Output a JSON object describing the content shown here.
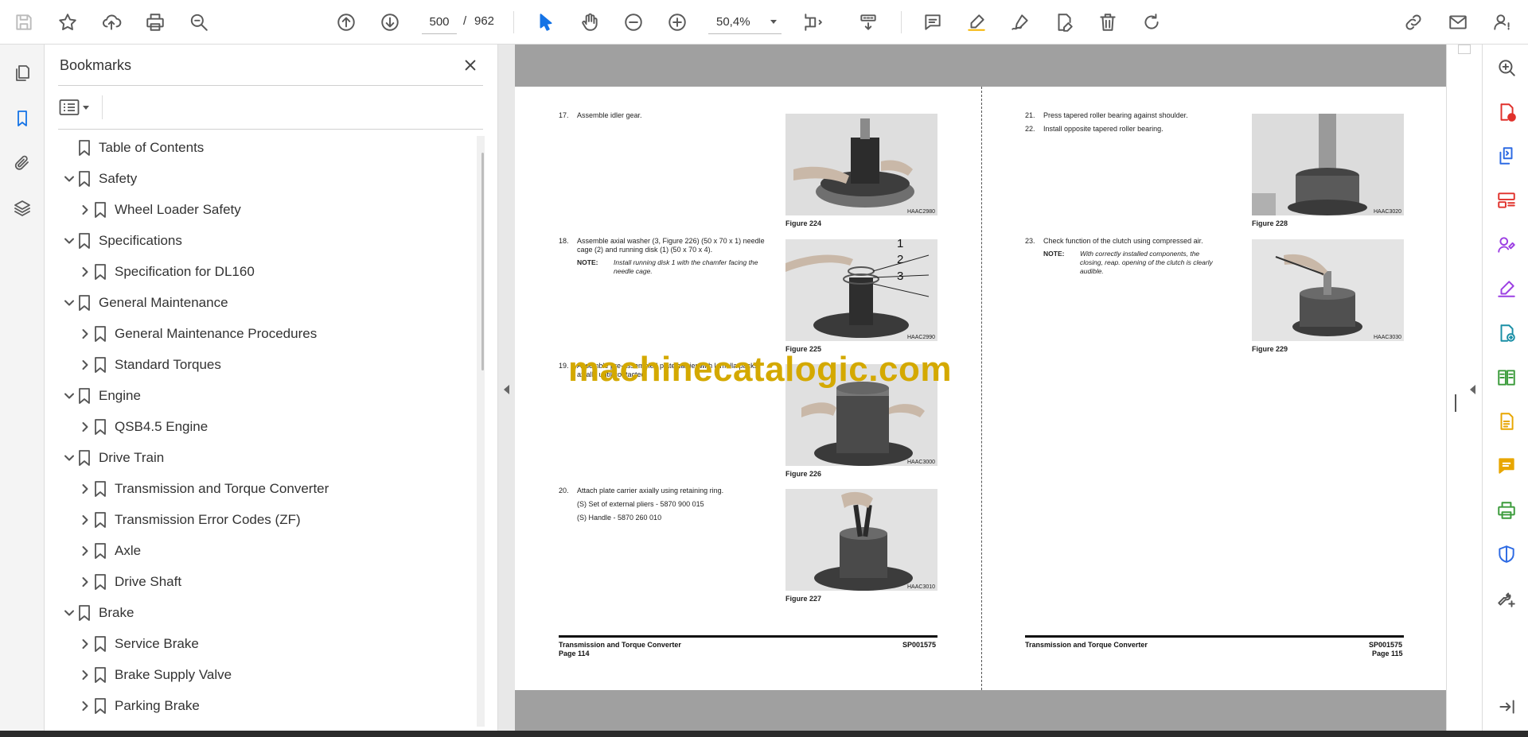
{
  "toolbar": {
    "page_current": "500",
    "page_separator": "/",
    "page_total": "962",
    "zoom": "50,4%"
  },
  "bookmarks": {
    "title": "Bookmarks",
    "items": [
      {
        "label": "Table of Contents",
        "level": 0,
        "chevron": "none"
      },
      {
        "label": "Safety",
        "level": 0,
        "chevron": "down"
      },
      {
        "label": "Wheel Loader Safety",
        "level": 1,
        "chevron": "right"
      },
      {
        "label": "Specifications",
        "level": 0,
        "chevron": "down"
      },
      {
        "label": "Specification for DL160",
        "level": 1,
        "chevron": "right"
      },
      {
        "label": "General Maintenance",
        "level": 0,
        "chevron": "down"
      },
      {
        "label": "General Maintenance Procedures",
        "level": 1,
        "chevron": "right"
      },
      {
        "label": "Standard Torques",
        "level": 1,
        "chevron": "right"
      },
      {
        "label": "Engine",
        "level": 0,
        "chevron": "down"
      },
      {
        "label": "QSB4.5 Engine",
        "level": 1,
        "chevron": "right"
      },
      {
        "label": "Drive Train",
        "level": 0,
        "chevron": "down"
      },
      {
        "label": "Transmission and Torque Converter",
        "level": 1,
        "chevron": "right"
      },
      {
        "label": "Transmission Error Codes (ZF)",
        "level": 1,
        "chevron": "right"
      },
      {
        "label": "Axle",
        "level": 1,
        "chevron": "right"
      },
      {
        "label": "Drive Shaft",
        "level": 1,
        "chevron": "right"
      },
      {
        "label": "Brake",
        "level": 0,
        "chevron": "down"
      },
      {
        "label": "Service Brake",
        "level": 1,
        "chevron": "right"
      },
      {
        "label": "Brake Supply Valve",
        "level": 1,
        "chevron": "right"
      },
      {
        "label": "Parking Brake",
        "level": 1,
        "chevron": "right"
      }
    ]
  },
  "document": {
    "left_page": {
      "s17": {
        "num": "17.",
        "text": "Assemble idler gear."
      },
      "s18": {
        "num": "18.",
        "line1": "Assemble axial washer (3, Figure 226) (50 x 70 x 1) needle",
        "line2": "cage (2) and running disk (1) (50 x 70 x 4)."
      },
      "s18_note_label": "NOTE:",
      "s18_note_line1": "Install running disk 1 with the chamfer facing the",
      "s18_note_line2": "needle cage.",
      "s19": {
        "num": "19.",
        "line1": "Assemble pre-assembled plate carrier with lamella packs",
        "line2": "axially until contacted."
      },
      "s20": {
        "num": "20.",
        "text": "Attach plate carrier axially using retaining ring."
      },
      "s20_tool1": "(S) Set of external pliers - 5870 900 015",
      "s20_tool2": "(S) Handle - 5870 260 010",
      "fig224": {
        "caption": "Figure 224",
        "code": "HAAC2980"
      },
      "fig225": {
        "caption": "Figure 225",
        "code": "HAAC2990",
        "callouts": [
          "1",
          "2",
          "3"
        ]
      },
      "fig226": {
        "caption": "Figure 226",
        "code": "HAAC3000"
      },
      "fig227": {
        "caption": "Figure 227",
        "code": "HAAC3010"
      },
      "footer_left": "Transmission and Torque Converter",
      "footer_page": "Page 114",
      "footer_code": "SP001575"
    },
    "right_page": {
      "s21": {
        "num": "21.",
        "text": "Press tapered roller bearing against shoulder."
      },
      "s22": {
        "num": "22.",
        "text": "Install opposite tapered roller bearing."
      },
      "s23": {
        "num": "23.",
        "text": "Check function of the clutch using compressed air."
      },
      "s23_note_label": "NOTE:",
      "s23_note_line1": "With correctly installed components, the",
      "s23_note_line2": "closing, reap. opening of the clutch is clearly",
      "s23_note_line3": "audible.",
      "fig228": {
        "caption": "Figure 228",
        "code": "HAAC3020"
      },
      "fig229": {
        "caption": "Figure 229",
        "code": "HAAC3030"
      },
      "footer_left": "Transmission and Torque Converter",
      "footer_page": "Page 115",
      "footer_code": "SP001575"
    },
    "watermark": "machinecatalogic.com"
  },
  "colors": {
    "accent": "#1473e6",
    "watermark": "#d4a900",
    "doc_background": "#a0a0a0"
  },
  "icons": {
    "toolbar": [
      "save-icon",
      "star-icon",
      "upload-icon",
      "print-icon",
      "zoom-search-icon",
      "page-up-icon",
      "page-down-icon",
      "select-cursor-icon",
      "hand-icon",
      "zoom-out-icon",
      "zoom-in-icon",
      "fit-page-icon",
      "scroll-mode-icon",
      "comment-icon",
      "highlight-icon",
      "sign-icon",
      "edit-pdf-icon",
      "delete-icon",
      "rotate-icon",
      "share-link-icon",
      "mail-icon",
      "account-icon"
    ],
    "right_rail": [
      "search-tool-icon",
      "export-pdf-icon",
      "create-pdf-icon",
      "organize-pages-icon",
      "fill-sign-icon",
      "edit-icon",
      "send-review-icon",
      "compare-icon",
      "export-icon",
      "comment-tool-icon",
      "print-production-icon",
      "protect-icon",
      "more-tools-icon",
      "expand-panel-icon"
    ]
  }
}
